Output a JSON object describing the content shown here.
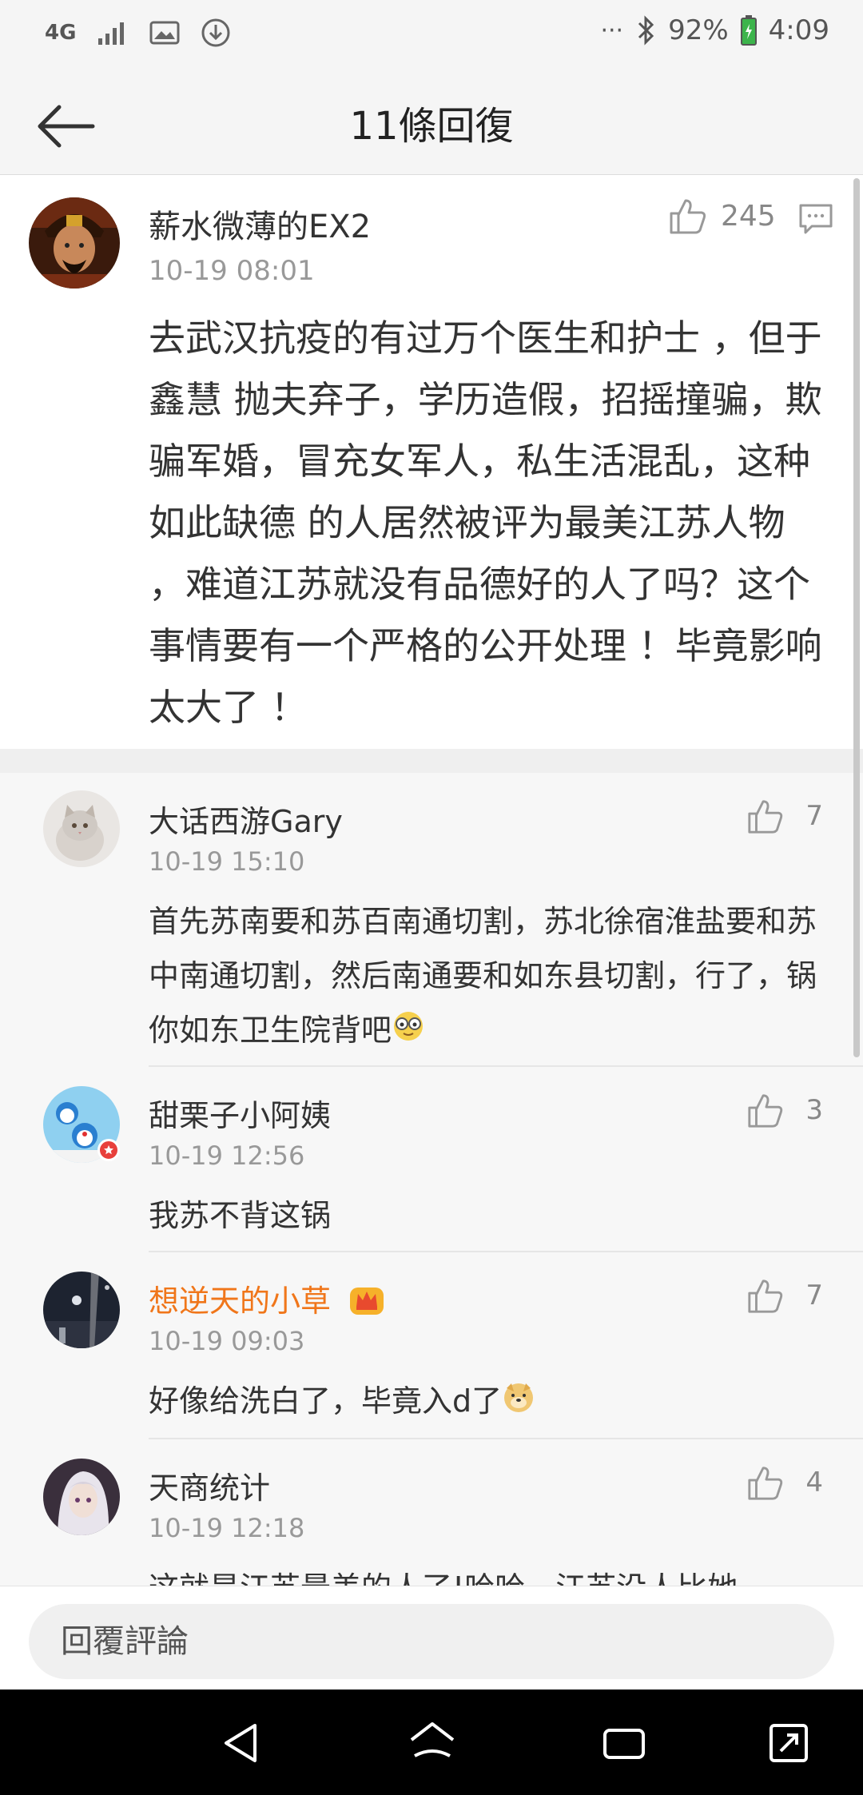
{
  "status_bar": {
    "network": "4G",
    "battery": "92%",
    "time": "4:09",
    "more": "···"
  },
  "header": {
    "title": "11條回復"
  },
  "main_comment": {
    "user": "薪水微薄的EX2",
    "time": "10-19 08:01",
    "likes": "245",
    "text": "去武汉抗疫的有过万个医生和护士 ，但于鑫慧  抛夫弃子，学历造假，招摇撞骗，欺骗军婚，冒充女军人，私生活混乱，这种如此缺德 的人居然被评为最美江苏人物 ，难道江苏就没有品德好的人了吗？这个事情要有一个严格的公开处理 ！毕竟影响太大了 ！"
  },
  "replies": [
    {
      "user": "大话西游Gary",
      "time": "10-19 15:10",
      "likes": "7",
      "text": "首先苏南要和苏百南通切割，苏北徐宿淮盐要和苏中南通切割，然后南通要和如东县切割，行了，锅你如东卫生院背吧"
    },
    {
      "user": "甜栗子小阿姨",
      "time": "10-19 12:56",
      "likes": "3",
      "text": "我苏不背这锅"
    },
    {
      "user": "想逆天的小草",
      "time": "10-19 09:03",
      "likes": "7",
      "text": "好像给洗白了，毕竟入d了"
    },
    {
      "user": "天商统计",
      "time": "10-19 12:18",
      "likes": "4",
      "text": "这就是江苏最美的人了!哈哈，江苏没人比她"
    }
  ],
  "reply_input": {
    "placeholder": "回覆評論"
  },
  "colors": {
    "vip_name": "#f0761a",
    "meta_gray": "#999999",
    "background": "#ffffff",
    "reply_background": "#f7f7f7"
  }
}
